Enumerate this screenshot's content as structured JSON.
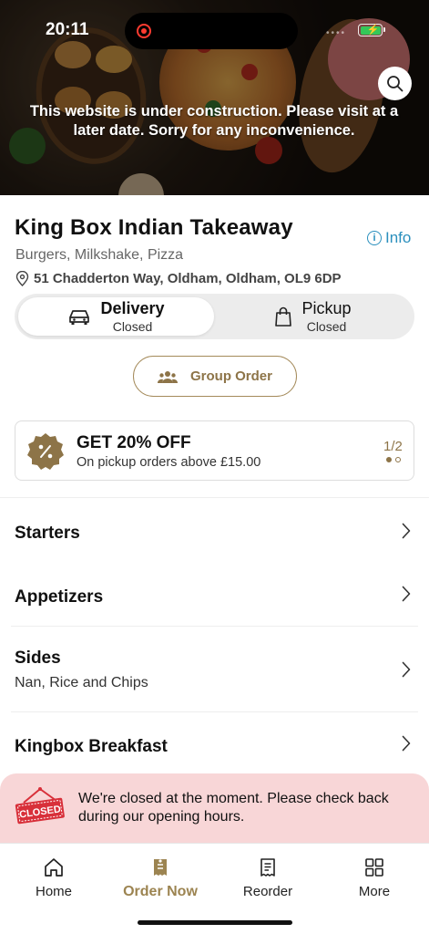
{
  "status_bar": {
    "time": "20:11"
  },
  "hero": {
    "construction_notice": "This website is under construction. Please visit at a later date. Sorry for any inconvenience."
  },
  "restaurant": {
    "name": "King Box Indian Takeaway",
    "info_label": "Info",
    "cuisines": "Burgers, Milkshake, Pizza",
    "address": "51 Chadderton Way, Oldham, Oldham, OL9 6DP"
  },
  "fulfilment": {
    "delivery": {
      "label": "Delivery",
      "status": "Closed",
      "selected": true
    },
    "pickup": {
      "label": "Pickup",
      "status": "Closed",
      "selected": false
    }
  },
  "group_order": {
    "label": "Group Order"
  },
  "promo": {
    "title": "GET 20% OFF",
    "subtitle": "On pickup orders above £15.00",
    "page_indicator": "1/2"
  },
  "categories": [
    {
      "name": "Starters",
      "description": ""
    },
    {
      "name": "Appetizers",
      "description": ""
    },
    {
      "name": "Sides",
      "description": "Nan, Rice and Chips"
    },
    {
      "name": "Kingbox Breakfast",
      "description": ""
    }
  ],
  "closed_banner": {
    "sign_text": "CLOSED",
    "message": "We're closed at the moment. Please check back during our opening hours."
  },
  "bottom_nav": [
    {
      "label": "Home",
      "icon": "home-icon",
      "active": false
    },
    {
      "label": "Order Now",
      "icon": "order-icon",
      "active": true
    },
    {
      "label": "Reorder",
      "icon": "receipt-icon",
      "active": false
    },
    {
      "label": "More",
      "icon": "grid-icon",
      "active": false
    }
  ],
  "colors": {
    "accent": "#9c8451",
    "link": "#2a8fbd",
    "closed_banner_bg": "#f8d6d7",
    "closed_sign": "#d8303a"
  }
}
